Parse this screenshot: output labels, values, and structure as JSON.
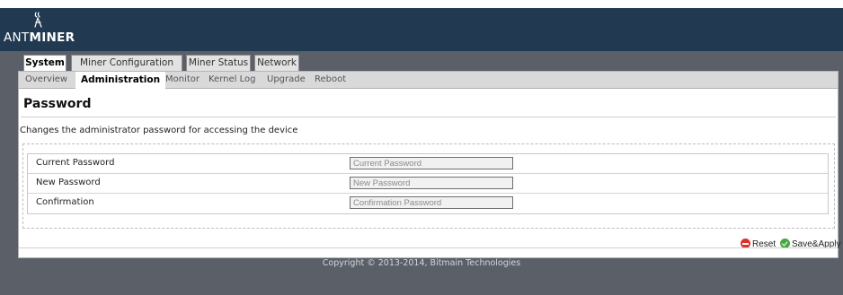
{
  "header": {
    "logo_text_prefix": "ANT",
    "logo_text_suffix": "MINER",
    "logo_icon": "antminer-logo-icon"
  },
  "main_tabs": [
    {
      "label": "System",
      "active": true
    },
    {
      "label": "Miner Configuration",
      "active": false
    },
    {
      "label": "Miner Status",
      "active": false
    },
    {
      "label": "Network",
      "active": false
    }
  ],
  "sub_tabs": [
    {
      "label": "Overview",
      "active": false
    },
    {
      "label": "Administration",
      "active": true
    },
    {
      "label": "Monitor",
      "active": false
    },
    {
      "label": "Kernel Log",
      "active": false
    },
    {
      "label": "Upgrade",
      "active": false
    },
    {
      "label": "Reboot",
      "active": false
    }
  ],
  "page": {
    "title": "Password",
    "description": "Changes the administrator password for accessing the device"
  },
  "form": {
    "fields": [
      {
        "label": "Current Password",
        "placeholder": "Current Password",
        "value": ""
      },
      {
        "label": "New Password",
        "placeholder": "New Password",
        "value": ""
      },
      {
        "label": "Confirmation",
        "placeholder": "Confirmation Password",
        "value": ""
      }
    ]
  },
  "actions": {
    "reset_label": "Reset",
    "save_label": "Save&Apply"
  },
  "colors": {
    "header_bg": "#213a52",
    "page_bg": "#5a5f68",
    "reset_icon": "#d9342b",
    "save_icon": "#49a844"
  },
  "footer": {
    "copyright": "Copyright © 2013-2014, Bitmain Technologies"
  }
}
